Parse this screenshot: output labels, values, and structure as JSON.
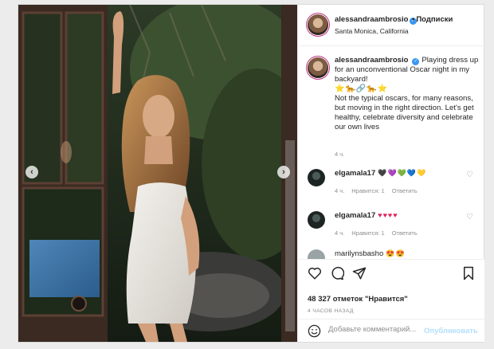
{
  "post": {
    "username": "alessandraambrosio",
    "verified_mark": "✓",
    "follow_label": "Подписки",
    "location": "Santa Monica, California"
  },
  "caption": {
    "username": "alessandraambrosio",
    "text": "Playing dress up for an unconventional Oscar night in my backyard!",
    "emojis": "⭐🐆🔗🐆⭐",
    "text2": "Not the typical oscars, for many reasons, but moving in the right direction. Let's get healthy, celebrate diversity and celebrate our own lives",
    "time": "4 ч."
  },
  "comments": [
    {
      "username": "elgamala17",
      "emojis": "🖤💜💚💙💛",
      "time": "4 ч.",
      "likes": "Нравится: 1",
      "reply": "Ответить"
    },
    {
      "username": "elgamala17",
      "emojis": "♥♥♥♥",
      "time": "4 ч.",
      "likes": "Нравится: 1",
      "reply": "Ответить"
    },
    {
      "username": "marilynsbasho",
      "emojis": "😍😍"
    }
  ],
  "stats": {
    "likes": "48 327 отметок \"Нравится\"",
    "ago": "4 ЧАСОВ НАЗАД"
  },
  "comment_box": {
    "placeholder": "Добавьте комментарий...",
    "publish_label": "Опубликовать"
  },
  "carousel": {
    "prev": "‹",
    "next": "›"
  },
  "icons": [
    "heart-icon",
    "comment-icon",
    "share-icon",
    "bookmark-icon",
    "smile-icon",
    "verified-icon"
  ],
  "colors": {
    "link": "#3897f0",
    "publish_disabled": "#b2dffc",
    "meta": "#8e8e8e",
    "text": "#262626"
  }
}
